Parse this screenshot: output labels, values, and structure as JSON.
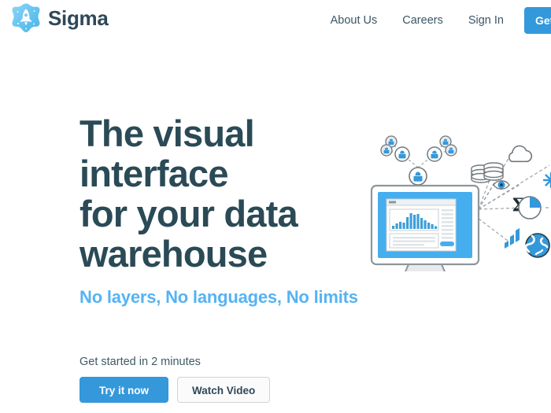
{
  "brand": {
    "name": "Sigma",
    "logo_icon": "rocket-blob-icon"
  },
  "nav": {
    "links": [
      {
        "label": "About Us"
      },
      {
        "label": "Careers"
      },
      {
        "label": "Sign In"
      }
    ],
    "cta_label": "Get Started"
  },
  "hero": {
    "title_lines": [
      "The visual",
      "interface",
      "for your data",
      "warehouse"
    ],
    "title": "The visual interface for your data warehouse",
    "subtitle": "No layers, No languages, No limits",
    "cta_kicker": "Get started in 2 minutes",
    "primary_button": "Try it now",
    "secondary_button": "Watch Video",
    "illustration": {
      "name": "data-warehouse-illustration",
      "monitor_icon": "desktop-monitor-dashboard-icon",
      "user_nodes_icon": "user-network-tree-icon",
      "source_icons": [
        "database-stack-icon",
        "cloud-icon",
        "eye-icon",
        "sigma-icon",
        "snowflake-icon",
        "pie-chart-icon",
        "bar-chart-icon",
        "globe-icon"
      ],
      "sigma_symbol": "Σ"
    }
  },
  "colors": {
    "brand_blue": "#3498db",
    "light_blue": "#55b3f3",
    "heading_slate": "#2a4a56",
    "body_slate": "#3f5a66",
    "page_background": "#ffffff"
  }
}
